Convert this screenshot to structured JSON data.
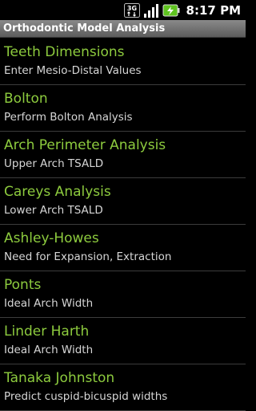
{
  "status_bar": {
    "network_label": "3G",
    "time": "8:17",
    "period": "PM"
  },
  "title_bar": {
    "title": "Orthodontic Model Analysis"
  },
  "menu": {
    "items": [
      {
        "title": "Teeth Dimensions",
        "subtitle": "Enter Mesio-Distal Values"
      },
      {
        "title": "Bolton",
        "subtitle": "Perform Bolton Analysis"
      },
      {
        "title": "Arch Perimeter Analysis",
        "subtitle": "Upper Arch TSALD"
      },
      {
        "title": "Careys Analysis",
        "subtitle": "Lower Arch TSALD"
      },
      {
        "title": "Ashley-Howes",
        "subtitle": "Need for Expansion, Extraction"
      },
      {
        "title": "Ponts",
        "subtitle": "Ideal Arch Width"
      },
      {
        "title": "Linder Harth",
        "subtitle": "Ideal Arch Width"
      },
      {
        "title": "Tanaka Johnston",
        "subtitle": "Predict cuspid-bicuspid widths"
      }
    ]
  },
  "colors": {
    "item_title": "#8dcb3e",
    "item_subtitle": "#d6d6d6",
    "background": "#000000",
    "battery": "#5fc31f"
  }
}
